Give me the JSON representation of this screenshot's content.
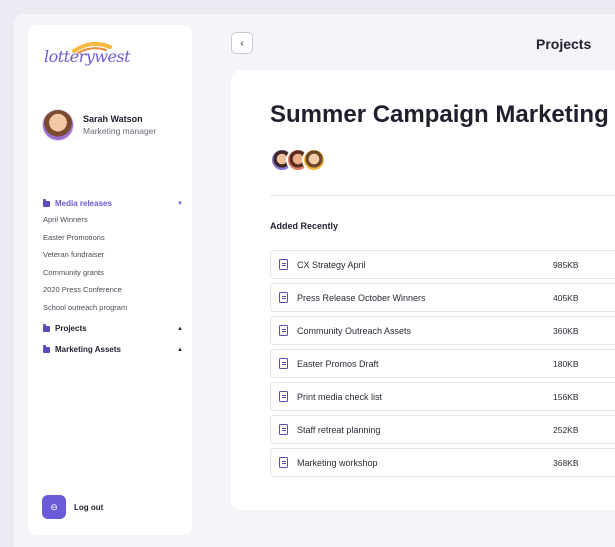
{
  "brand": {
    "logo_text": "lotterywest"
  },
  "user": {
    "name": "Sarah Watson",
    "role": "Marketing manager"
  },
  "nav": {
    "media_releases": {
      "label": "Media releases",
      "items": [
        "April Winners",
        "Easter Promotions",
        "Veteran fundraiser",
        "Community grants",
        "2020 Press Conference",
        "School outreach program"
      ]
    },
    "projects": {
      "label": "Projects"
    },
    "marketing_assets": {
      "label": "Marketing Assets"
    }
  },
  "logout": {
    "label": "Log out"
  },
  "header": {
    "title": "Projects"
  },
  "project": {
    "title": "Summer Campaign Marketing"
  },
  "files": {
    "section_title": "Added Recently",
    "rows": [
      {
        "name": "CX Strategy April",
        "size": "985KB"
      },
      {
        "name": "Press Release October Winners",
        "size": "405KB"
      },
      {
        "name": "Community Outreach Assets",
        "size": "360KB"
      },
      {
        "name": "Easter Promos Draft",
        "size": "180KB"
      },
      {
        "name": "Print media check list",
        "size": "156KB"
      },
      {
        "name": "Staff retreat planning",
        "size": "252KB"
      },
      {
        "name": "Marketing workshop",
        "size": "368KB"
      }
    ]
  },
  "colors": {
    "accent": "#6b5bd6",
    "background": "#ebebf3",
    "card": "#ffffff"
  }
}
